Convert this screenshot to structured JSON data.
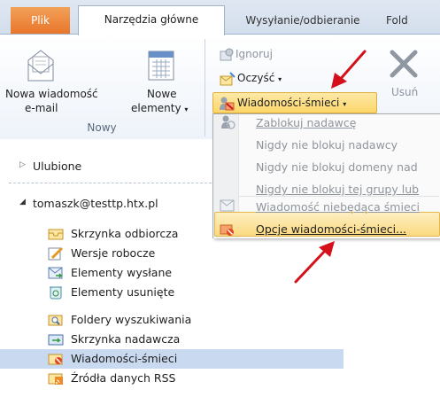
{
  "tabs": {
    "file": "Plik",
    "home": "Narzędzia główne",
    "send_receive": "Wysyłanie/odbieranie",
    "folder": "Fold"
  },
  "ribbon": {
    "new_email_line1": "Nowa wiadomość",
    "new_email_line2": "e-mail",
    "new_items_line1": "Nowe",
    "new_items_line2": "elementy",
    "group_new": "Nowy",
    "ignore": "Ignoruj",
    "clean_up": "Oczyść",
    "junk": "Wiadomości-śmieci",
    "delete": "Usuń"
  },
  "junk_menu": {
    "items": [
      "Zablokuj nadawcę",
      "Nigdy nie blokuj nadawcy",
      "Nigdy nie blokuj domeny nad",
      "Nigdy nie blokuj tej grupy lub",
      "Wiadomość niebędąca śmieci",
      "Opcje wiadomości-śmieci..."
    ]
  },
  "nav": {
    "favorites": "Ulubione",
    "account": "tomaszk@testtp.htx.pl",
    "folders": [
      "Skrzynka odbiorcza",
      "Wersje robocze",
      "Elementy wysłane",
      "Elementy usunięte",
      "Foldery wyszukiwania",
      "Skrzynka nadawcza",
      "Wiadomości-śmieci",
      "Źródła danych RSS"
    ]
  },
  "colors": {
    "file_tab": "#e8762b",
    "selection": "#c9d9ef",
    "highlight": "#fbd980",
    "arrow": "#d4111b"
  }
}
